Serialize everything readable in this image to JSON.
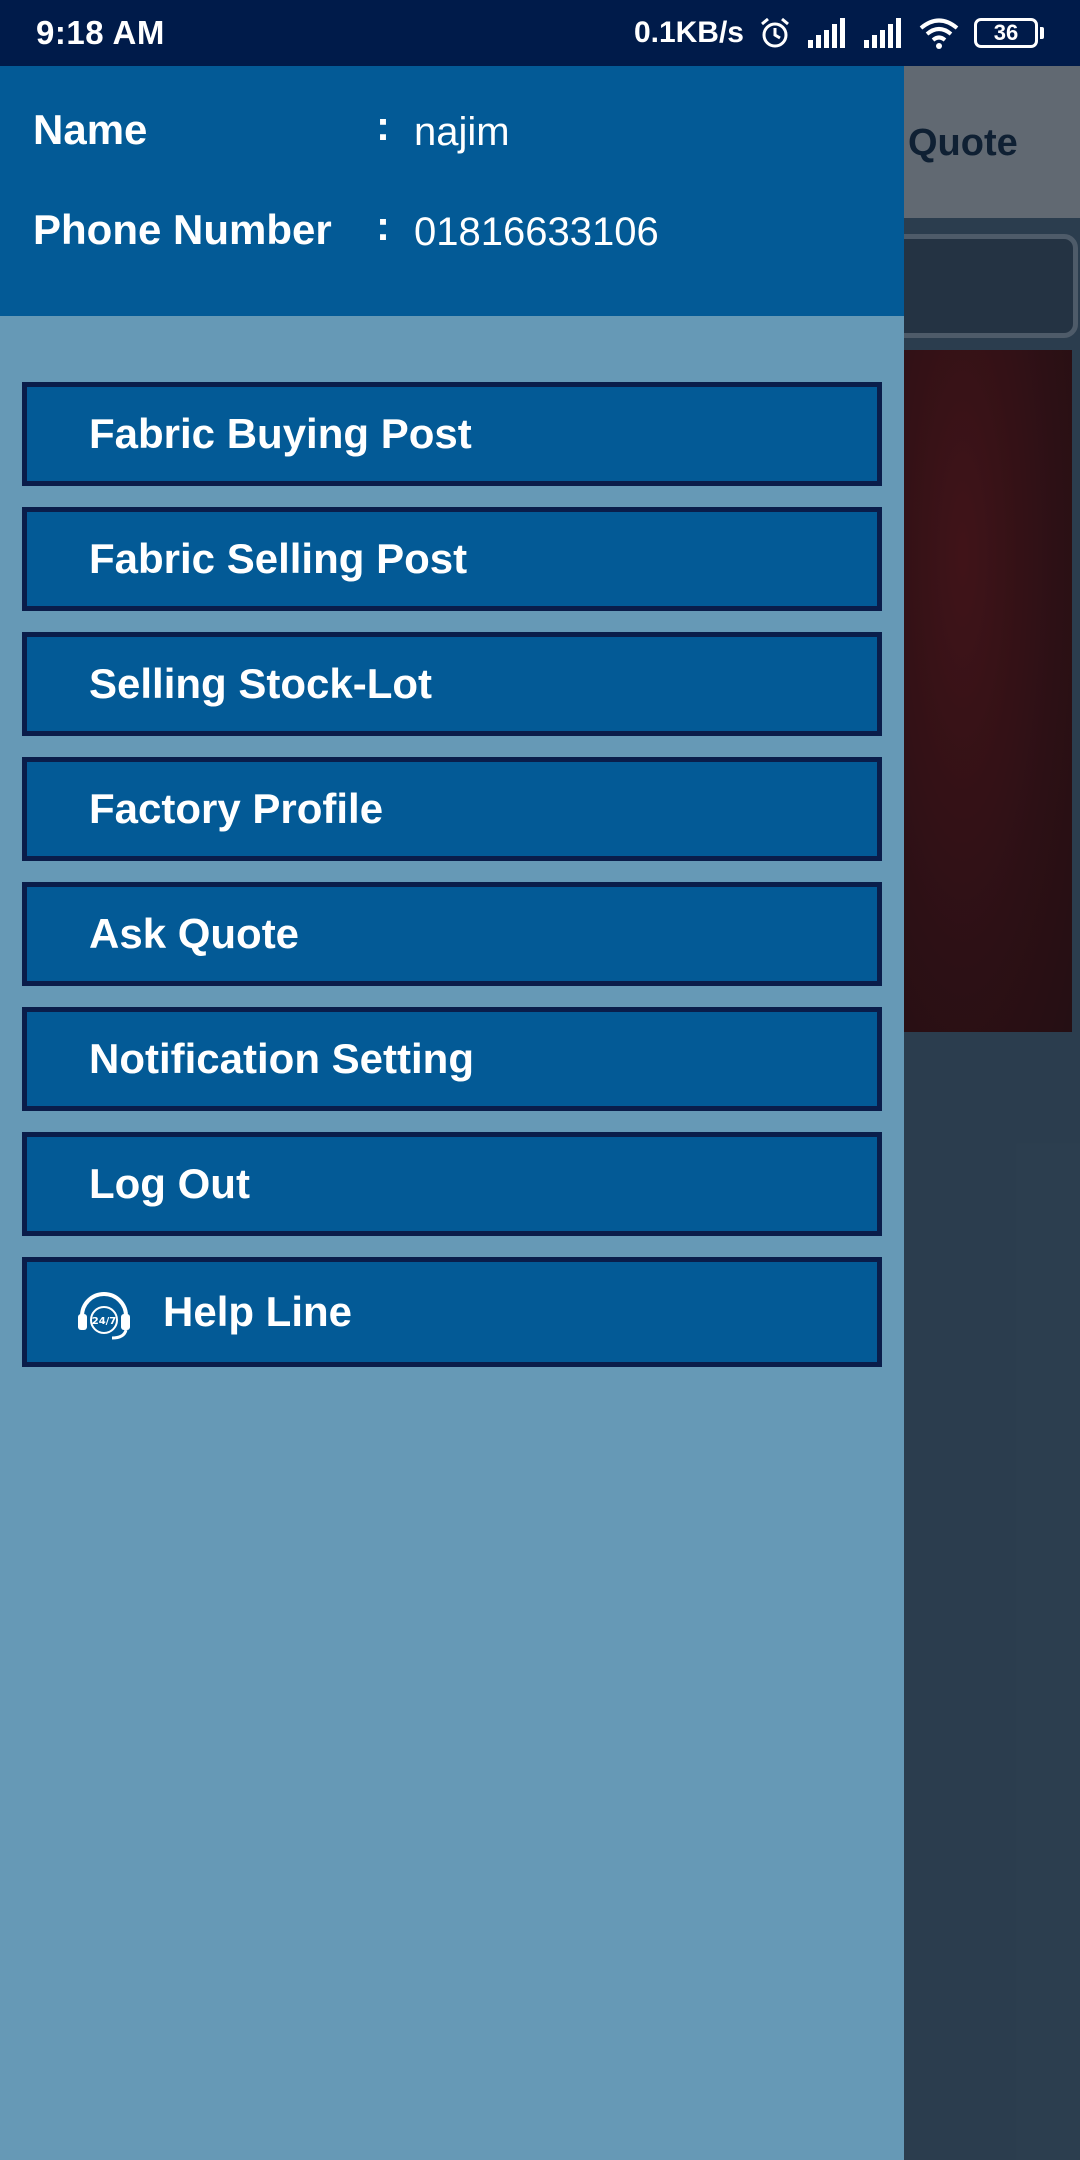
{
  "status_bar": {
    "time": "9:18 AM",
    "net_speed": "0.1KB/s",
    "battery": "36",
    "icons": [
      "alarm-icon",
      "signal-icon",
      "signal-icon",
      "wifi-icon",
      "battery-icon"
    ]
  },
  "background_app": {
    "title_partial": "Quote"
  },
  "drawer": {
    "profile": {
      "name_label": "Name",
      "name_value": "najim",
      "phone_label": "Phone Number",
      "phone_value": "01816633106",
      "separator": ":"
    },
    "menu": [
      {
        "label": "Fabric Buying Post"
      },
      {
        "label": "Fabric Selling Post"
      },
      {
        "label": "Selling Stock-Lot"
      },
      {
        "label": "Factory Profile"
      },
      {
        "label": "Ask Quote"
      },
      {
        "label": "Notification Setting"
      },
      {
        "label": "Log Out"
      },
      {
        "label": "Help Line",
        "icon": "headset-24-7-icon"
      }
    ]
  },
  "colors": {
    "status_bar": "#001b4a",
    "drawer_header": "#035a96",
    "drawer_body": "#6699b6",
    "menu_item": "#035a96",
    "menu_border": "#0a1d4a"
  }
}
